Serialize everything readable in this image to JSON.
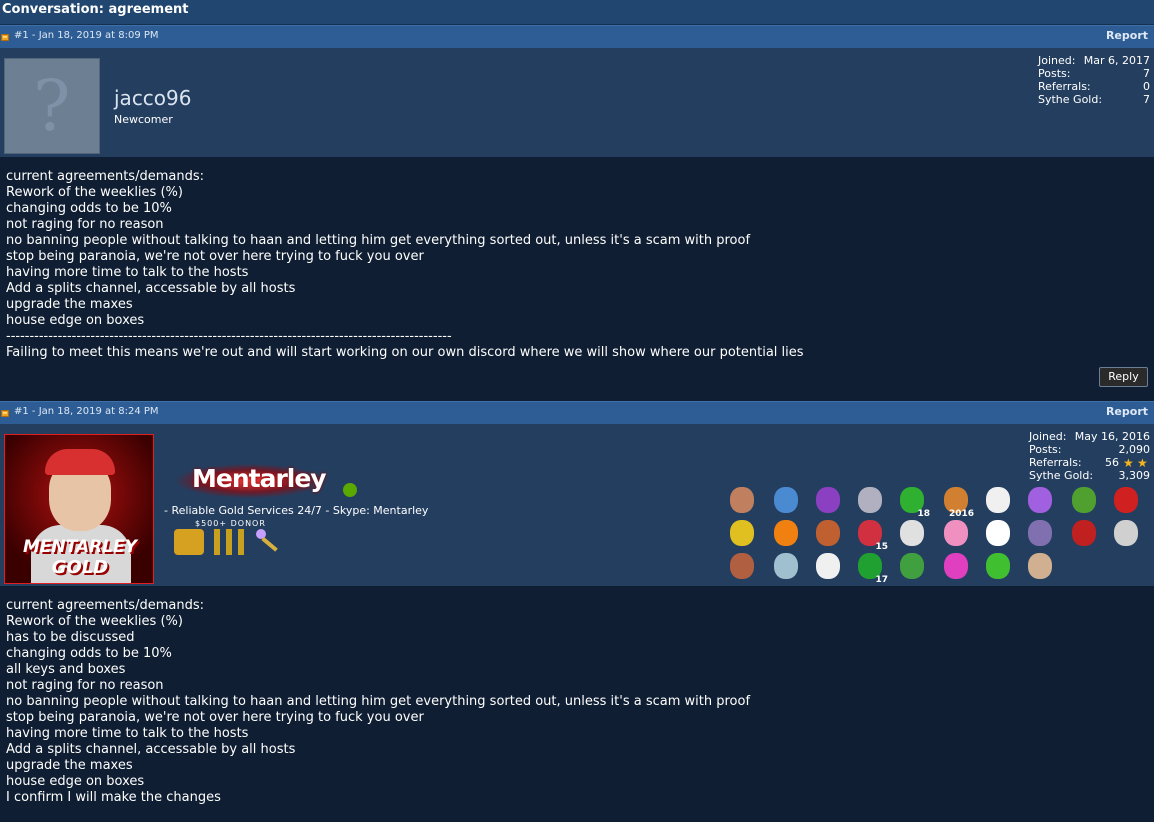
{
  "conversation": {
    "title": "Conversation: agreement"
  },
  "posts": [
    {
      "meta": "#1 - Jan 18, 2019 at 8:09 PM",
      "report": "Report",
      "username": "jacco96",
      "user_title": "Newcomer",
      "stats": [
        {
          "label": "Joined:",
          "value": "Mar 6, 2017"
        },
        {
          "label": "Posts:",
          "value": "7"
        },
        {
          "label": "Referrals:",
          "value": "0"
        },
        {
          "label": "Sythe Gold:",
          "value": "7"
        }
      ],
      "body": [
        "current agreements/demands:",
        "Rework of the weeklies (%)",
        "changing odds to be 10%",
        "not raging for no reason",
        "no banning people without talking to haan and letting him get everything sorted out, unless it's a scam with proof",
        "stop being paranoia, we're not over here trying to fuck you over",
        "having more time to talk to the hosts",
        "Add a splits channel, accessable by all hosts",
        "upgrade the maxes",
        "house edge on boxes",
        "-----------------------------------------------------------------------------------------------",
        "Failing to meet this means we're out and will start working on our own discord where we will show where our potential lies"
      ],
      "reply": "Reply"
    },
    {
      "meta": "#1 - Jan 18, 2019 at 8:24 PM",
      "report": "Report",
      "username": "Mentarley",
      "user_title": "- Reliable Gold Services 24/7 - Skype: Mentarley",
      "avatar_text": [
        "MENTARLEY",
        "GOLD"
      ],
      "donor_label": "$500+ DONOR",
      "stats": [
        {
          "label": "Joined:",
          "value": "May 16, 2016"
        },
        {
          "label": "Posts:",
          "value": "2,090"
        },
        {
          "label": "Referrals:",
          "value": "56"
        },
        {
          "label": "Sythe Gold:",
          "value": "3,309"
        }
      ],
      "trophies": [
        {
          "icon": "mouse-trophy-icon",
          "color": "#c08060"
        },
        {
          "icon": "dragon-trophy-icon",
          "color": "#4a8ad0"
        },
        {
          "icon": "purple-creature-trophy-icon",
          "color": "#8a40c0"
        },
        {
          "icon": "skull-trophy-icon",
          "color": "#b0b0c0"
        },
        {
          "icon": "clover-trophy-icon",
          "color": "#30b030",
          "num": "18"
        },
        {
          "icon": "firework-trophy-icon",
          "color": "#d08030",
          "num": "2016"
        },
        {
          "icon": "mask-trophy-icon",
          "color": "#f0f0f0"
        },
        {
          "icon": "purple-blob-trophy-icon",
          "color": "#a060e0"
        },
        {
          "icon": "pepe-trophy-icon",
          "color": "#50a030"
        },
        {
          "icon": "red-ribbon-trophy-icon",
          "color": "#d02020"
        },
        {
          "icon": "anarchy-trophy-icon",
          "color": "#e0c020"
        },
        {
          "icon": "dragon-ball-trophy-icon",
          "color": "#f08010"
        },
        {
          "icon": "pizza-trophy-icon",
          "color": "#c06030"
        },
        {
          "icon": "rose-trophy-icon",
          "color": "#d03040",
          "num": "15"
        },
        {
          "icon": "wrench-trophy-icon",
          "color": "#e0e0e0"
        },
        {
          "icon": "gem-trophy-icon",
          "color": "#f090c0"
        },
        {
          "icon": "white-ribbon-trophy-icon",
          "color": "#ffffff"
        },
        {
          "icon": "wizard-trophy-icon",
          "color": "#8070b0"
        },
        {
          "icon": "meatball-trophy-icon",
          "color": "#c02020"
        },
        {
          "icon": "scroll-trophy-icon",
          "color": "#d0d0d0"
        },
        {
          "icon": "face-trophy-icon",
          "color": "#b06040"
        },
        {
          "icon": "rick-trophy-icon",
          "color": "#a0c0d0"
        },
        {
          "icon": "penguin-trophy-icon",
          "color": "#f0f0f0"
        },
        {
          "icon": "leprechaun-hat-trophy-icon",
          "color": "#20a030",
          "num": "17"
        },
        {
          "icon": "creeper-trophy-icon",
          "color": "#40a040"
        },
        {
          "icon": "rainbow-trophy-icon",
          "color": "#e040c0"
        },
        {
          "icon": "frog-trophy-icon",
          "color": "#40c030"
        },
        {
          "icon": "llama-trophy-icon",
          "color": "#d0b090"
        }
      ],
      "body": [
        "current agreements/demands:",
        "Rework of the weeklies (%)",
        "has to be discussed",
        "changing odds to be 10%",
        "all keys and boxes",
        "not raging for no reason",
        "no banning people without talking to haan and letting him get everything sorted out, unless it's a scam with proof",
        "stop being paranoia, we're not over here trying to fuck you over",
        "having more time to talk to the hosts",
        "Add a splits channel, accessable by all hosts",
        "upgrade the maxes",
        "house edge on boxes",
        "I confirm I will make the changes"
      ]
    }
  ]
}
